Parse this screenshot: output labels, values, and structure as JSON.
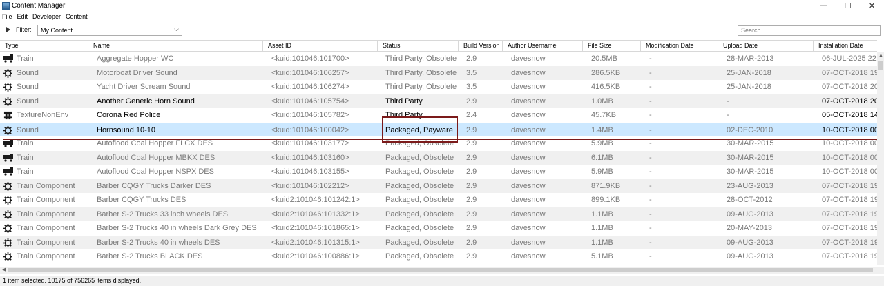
{
  "window": {
    "title": "Content Manager",
    "controls": {
      "minimize": "—",
      "maximize": "☐",
      "close": "✕"
    }
  },
  "menu": [
    "File",
    "Edit",
    "Developer",
    "Content"
  ],
  "filter": {
    "label": "Filter:",
    "selected": "My Content",
    "search_placeholder": "Search"
  },
  "columns": [
    "Type",
    "Name",
    "Asset ID",
    "Status",
    "Build Version",
    "Author Username",
    "File Size",
    "Modification Date",
    "Upload Date",
    "Installation Date"
  ],
  "rows": [
    {
      "icon": "train-icon",
      "type": "Train",
      "name": "Aggregate Hopper WC",
      "asset_id": "<kuid:101046:101700>",
      "status": "Third Party, Obsolete",
      "build": "2.9",
      "author": "davesnow",
      "size": "20.5MB",
      "mod": "-",
      "upload": "28-MAR-2013",
      "install": "06-JUL-2025 22:",
      "emphasis": false
    },
    {
      "icon": "gear-icon",
      "type": "Sound",
      "name": "Motorboat Driver Sound",
      "asset_id": "<kuid:101046:106257>",
      "status": "Third Party, Obsolete",
      "build": "3.5",
      "author": "davesnow",
      "size": "286.5KB",
      "mod": "-",
      "upload": "25-JAN-2018",
      "install": "07-OCT-2018 19",
      "emphasis": false
    },
    {
      "icon": "gear-icon",
      "type": "Sound",
      "name": "Yacht Driver Scream Sound",
      "asset_id": "<kuid:101046:106274>",
      "status": "Third Party, Obsolete",
      "build": "3.5",
      "author": "davesnow",
      "size": "416.5KB",
      "mod": "-",
      "upload": "25-JAN-2018",
      "install": "07-OCT-2018 20",
      "emphasis": false
    },
    {
      "icon": "gear-icon",
      "type": "Sound",
      "name": "Another Generic Horn Sound",
      "asset_id": "<kuid:101046:105754>",
      "status": "Third Party",
      "build": "2.9",
      "author": "davesnow",
      "size": "1.0MB",
      "mod": "-",
      "upload": "-",
      "install": "07-OCT-2018 20",
      "emphasis": true
    },
    {
      "icon": "texture-icon",
      "type": "TextureNonEnv",
      "name": "Corona Red Police",
      "asset_id": "<kuid:101046:105782>",
      "status": "Third Party",
      "build": "2.4",
      "author": "davesnow",
      "size": "45.7KB",
      "mod": "-",
      "upload": "-",
      "install": "05-OCT-2018 14",
      "emphasis": true
    },
    {
      "icon": "gear-icon",
      "type": "Sound",
      "name": "Hornsound 10-10",
      "asset_id": "<kuid:101046:100042>",
      "status": "Packaged, Payware",
      "build": "2.9",
      "author": "davesnow",
      "size": "1.4MB",
      "mod": "-",
      "upload": "02-DEC-2010",
      "install": "10-OCT-2018 00",
      "emphasis": true,
      "selected": true
    },
    {
      "icon": "train-icon",
      "type": "Train",
      "name": "Autoflood Coal Hopper FLCX DES",
      "asset_id": "<kuid:101046:103177>",
      "status": "Packaged, Obsolete",
      "build": "2.9",
      "author": "davesnow",
      "size": "5.9MB",
      "mod": "-",
      "upload": "30-MAR-2015",
      "install": "10-OCT-2018 00",
      "emphasis": false
    },
    {
      "icon": "train-icon",
      "type": "Train",
      "name": "Autoflood Coal Hopper MBKX DES",
      "asset_id": "<kuid:101046:103160>",
      "status": "Packaged, Obsolete",
      "build": "2.9",
      "author": "davesnow",
      "size": "6.1MB",
      "mod": "-",
      "upload": "30-MAR-2015",
      "install": "10-OCT-2018 00",
      "emphasis": false
    },
    {
      "icon": "train-icon",
      "type": "Train",
      "name": "Autoflood Coal Hopper NSPX DES",
      "asset_id": "<kuid:101046:103155>",
      "status": "Packaged, Obsolete",
      "build": "2.9",
      "author": "davesnow",
      "size": "5.9MB",
      "mod": "-",
      "upload": "30-MAR-2015",
      "install": "10-OCT-2018 00",
      "emphasis": false
    },
    {
      "icon": "gear-icon",
      "type": "Train Component",
      "name": "Barber CQGY Trucks Darker DES",
      "asset_id": "<kuid:101046:102212>",
      "status": "Packaged, Obsolete",
      "build": "2.9",
      "author": "davesnow",
      "size": "871.9KB",
      "mod": "-",
      "upload": "23-AUG-2013",
      "install": "07-OCT-2018 19",
      "emphasis": false
    },
    {
      "icon": "gear-icon",
      "type": "Train Component",
      "name": "Barber CQGY Trucks DES",
      "asset_id": "<kuid2:101046:101242:1>",
      "status": "Packaged, Obsolete",
      "build": "2.9",
      "author": "davesnow",
      "size": "899.1KB",
      "mod": "-",
      "upload": "28-OCT-2012",
      "install": "07-OCT-2018 19",
      "emphasis": false
    },
    {
      "icon": "gear-icon",
      "type": "Train Component",
      "name": "Barber S-2 Trucks 33 inch wheels DES",
      "asset_id": "<kuid2:101046:101332:1>",
      "status": "Packaged, Obsolete",
      "build": "2.9",
      "author": "davesnow",
      "size": "1.1MB",
      "mod": "-",
      "upload": "09-AUG-2013",
      "install": "07-OCT-2018 19",
      "emphasis": false
    },
    {
      "icon": "gear-icon",
      "type": "Train Component",
      "name": "Barber S-2 Trucks 40 in wheels Dark Grey DES",
      "asset_id": "<kuid2:101046:101865:1>",
      "status": "Packaged, Obsolete",
      "build": "2.9",
      "author": "davesnow",
      "size": "1.1MB",
      "mod": "-",
      "upload": "20-MAY-2013",
      "install": "07-OCT-2018 19",
      "emphasis": false
    },
    {
      "icon": "gear-icon",
      "type": "Train Component",
      "name": "Barber S-2 Trucks 40 in wheels DES",
      "asset_id": "<kuid2:101046:101315:1>",
      "status": "Packaged, Obsolete",
      "build": "2.9",
      "author": "davesnow",
      "size": "1.1MB",
      "mod": "-",
      "upload": "09-AUG-2013",
      "install": "07-OCT-2018 19",
      "emphasis": false
    },
    {
      "icon": "gear-icon",
      "type": "Train Component",
      "name": "Barber S-2 Trucks BLACK DES",
      "asset_id": "<kuid2:101046:100886:1>",
      "status": "Packaged, Obsolete",
      "build": "2.9",
      "author": "davesnow",
      "size": "5.1MB",
      "mod": "-",
      "upload": "09-AUG-2013",
      "install": "07-OCT-2018 19",
      "emphasis": false
    }
  ],
  "status_bar": "1 item selected. 10175 of 756265 items displayed."
}
